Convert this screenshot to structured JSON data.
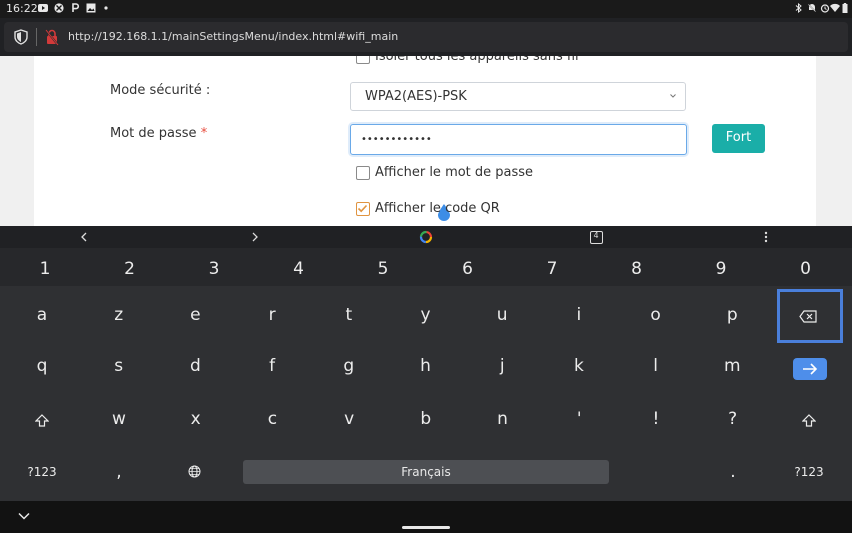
{
  "status_bar": {
    "time": "16:22",
    "left_icons": [
      "youtube-icon",
      "xbox-icon",
      "p-icon",
      "image-icon",
      "dot-icon"
    ],
    "right_icons": [
      "bluetooth-icon",
      "mute-icon",
      "alarm-icon",
      "wifi-icon",
      "battery-icon"
    ]
  },
  "browser": {
    "url": "http://192.168.1.1/mainSettingsMenu/index.html#wifi_main"
  },
  "page": {
    "top_checkbox_label": "Isoler tous les appareils sans fil",
    "security_mode_label": "Mode sécurité :",
    "security_mode_value": "WPA2(AES)-PSK",
    "password_label": "Mot de passe",
    "required_mark": "*",
    "password_value": "••••••••••••",
    "strength_label": "Fort",
    "show_password_label": "Afficher le mot de passe",
    "show_qr_label": "Afficher le code QR",
    "show_password_checked": false,
    "show_qr_checked": true
  },
  "keyboard": {
    "toolbar": [
      "chevron-left-icon",
      "chevron-right-icon",
      "gboard-icon",
      "clipboard-icon",
      "more-icon"
    ],
    "clipboard_count": "4",
    "numbers": [
      "1",
      "2",
      "3",
      "4",
      "5",
      "6",
      "7",
      "8",
      "9",
      "0"
    ],
    "row1": [
      "a",
      "z",
      "e",
      "r",
      "t",
      "y",
      "u",
      "i",
      "o",
      "p"
    ],
    "row2": [
      "q",
      "s",
      "d",
      "f",
      "g",
      "h",
      "j",
      "k",
      "l",
      "m"
    ],
    "row3": [
      "w",
      "x",
      "c",
      "v",
      "b",
      "n",
      "'",
      "!",
      "?"
    ],
    "sym_left": "?123",
    "comma": ",",
    "space": "Français",
    "period": ".",
    "sym_right": "?123"
  },
  "colors": {
    "accent_teal": "#1aaea8",
    "checkbox_checked": "#e09440",
    "enter_blue": "#4e8eea",
    "highlight_blue": "#4a7fdb"
  }
}
